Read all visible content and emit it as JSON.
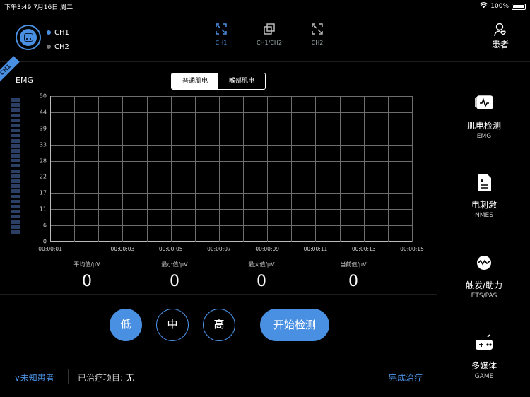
{
  "status_bar": {
    "time_date": "下午3:49   7月16日 周二",
    "battery": "100%"
  },
  "header": {
    "channels": [
      {
        "label": "CH1",
        "color": "#4a90e2"
      },
      {
        "label": "CH2",
        "color": "#777777"
      }
    ],
    "views": [
      "CH1",
      "CH1/CH2",
      "CH2"
    ],
    "patient_label": "患者"
  },
  "main": {
    "channel_tag": "CH1",
    "emg_label": "EMG",
    "segment": {
      "normal": "普通肌电",
      "pelvic": "喉部肌电"
    },
    "y_ticks": [
      "50",
      "44",
      "39",
      "33",
      "28",
      "22",
      "17",
      "11",
      "6",
      "0"
    ],
    "x_ticks": [
      "00:00:01",
      "00:00:03",
      "00:00:05",
      "00:00:07",
      "00:00:09",
      "00:00:11",
      "00:00:13",
      "00:00:15"
    ],
    "stats": [
      {
        "label": "平均值/μV",
        "value": "0"
      },
      {
        "label": "最小值/μV",
        "value": "0"
      },
      {
        "label": "最大值/μV",
        "value": "0"
      },
      {
        "label": "当前值/μV",
        "value": "0"
      }
    ],
    "levels": [
      "低",
      "中",
      "高"
    ],
    "start_button": "开始检测"
  },
  "footer": {
    "patient": "∨未知患者",
    "treated": "已治疗项目:",
    "treated_value": "无",
    "complete": "完成治疗"
  },
  "sidebar": [
    {
      "title": "肌电检测",
      "sub": "EMG",
      "icon": "emg-icon"
    },
    {
      "title": "电刺激",
      "sub": "NMES",
      "icon": "nmes-icon"
    },
    {
      "title": "触发/助力",
      "sub": "ETS/PAS",
      "icon": "ets-icon"
    },
    {
      "title": "多媒体",
      "sub": "GAME",
      "icon": "game-icon"
    }
  ]
}
